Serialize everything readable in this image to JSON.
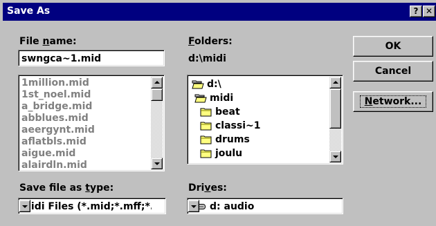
{
  "window": {
    "title": "Save As",
    "help_button": "?",
    "close_button": "✕"
  },
  "file_name": {
    "label_pre": "File ",
    "label_key": "n",
    "label_post": "ame:",
    "value": "swngca~1.mid"
  },
  "file_list": {
    "items": [
      "1million.mid",
      "1st_noel.mid",
      "a_bridge.mid",
      "abblues.mid",
      "aeergynt.mid",
      "aflatbls.mid",
      "aigue.mid",
      "alairdln.mid"
    ]
  },
  "folders": {
    "label_key": "F",
    "label_post": "olders:",
    "current_path": "d:\\midi",
    "items": [
      {
        "name": "d:\\",
        "icon": "open-folder-icon"
      },
      {
        "name": "midi",
        "icon": "open-folder-icon"
      },
      {
        "name": "beat",
        "icon": "folder-icon"
      },
      {
        "name": "classi~1",
        "icon": "folder-icon"
      },
      {
        "name": "drums",
        "icon": "folder-icon"
      },
      {
        "name": "joulu",
        "icon": "folder-icon"
      }
    ]
  },
  "save_type": {
    "label_pre": "Save file as ",
    "label_key": "t",
    "label_post": "ype:",
    "value": "Midi Files (*.mid;*.mff;*.r"
  },
  "drives": {
    "label_pre": "Dri",
    "label_key": "v",
    "label_post": "es:",
    "value": "d: audio",
    "icon": "drive-icon"
  },
  "buttons": {
    "ok": "OK",
    "cancel": "Cancel",
    "network_key": "N",
    "network_rest": "etwork..."
  }
}
